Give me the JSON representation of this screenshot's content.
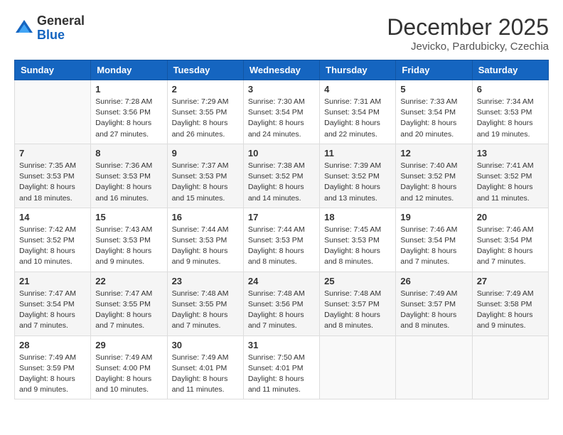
{
  "header": {
    "logo_general": "General",
    "logo_blue": "Blue",
    "month_year": "December 2025",
    "location": "Jevicko, Pardubicky, Czechia"
  },
  "days_of_week": [
    "Sunday",
    "Monday",
    "Tuesday",
    "Wednesday",
    "Thursday",
    "Friday",
    "Saturday"
  ],
  "weeks": [
    [
      {
        "day": "",
        "info": ""
      },
      {
        "day": "1",
        "info": "Sunrise: 7:28 AM\nSunset: 3:56 PM\nDaylight: 8 hours\nand 27 minutes."
      },
      {
        "day": "2",
        "info": "Sunrise: 7:29 AM\nSunset: 3:55 PM\nDaylight: 8 hours\nand 26 minutes."
      },
      {
        "day": "3",
        "info": "Sunrise: 7:30 AM\nSunset: 3:54 PM\nDaylight: 8 hours\nand 24 minutes."
      },
      {
        "day": "4",
        "info": "Sunrise: 7:31 AM\nSunset: 3:54 PM\nDaylight: 8 hours\nand 22 minutes."
      },
      {
        "day": "5",
        "info": "Sunrise: 7:33 AM\nSunset: 3:54 PM\nDaylight: 8 hours\nand 20 minutes."
      },
      {
        "day": "6",
        "info": "Sunrise: 7:34 AM\nSunset: 3:53 PM\nDaylight: 8 hours\nand 19 minutes."
      }
    ],
    [
      {
        "day": "7",
        "info": "Sunrise: 7:35 AM\nSunset: 3:53 PM\nDaylight: 8 hours\nand 18 minutes."
      },
      {
        "day": "8",
        "info": "Sunrise: 7:36 AM\nSunset: 3:53 PM\nDaylight: 8 hours\nand 16 minutes."
      },
      {
        "day": "9",
        "info": "Sunrise: 7:37 AM\nSunset: 3:53 PM\nDaylight: 8 hours\nand 15 minutes."
      },
      {
        "day": "10",
        "info": "Sunrise: 7:38 AM\nSunset: 3:52 PM\nDaylight: 8 hours\nand 14 minutes."
      },
      {
        "day": "11",
        "info": "Sunrise: 7:39 AM\nSunset: 3:52 PM\nDaylight: 8 hours\nand 13 minutes."
      },
      {
        "day": "12",
        "info": "Sunrise: 7:40 AM\nSunset: 3:52 PM\nDaylight: 8 hours\nand 12 minutes."
      },
      {
        "day": "13",
        "info": "Sunrise: 7:41 AM\nSunset: 3:52 PM\nDaylight: 8 hours\nand 11 minutes."
      }
    ],
    [
      {
        "day": "14",
        "info": "Sunrise: 7:42 AM\nSunset: 3:52 PM\nDaylight: 8 hours\nand 10 minutes."
      },
      {
        "day": "15",
        "info": "Sunrise: 7:43 AM\nSunset: 3:53 PM\nDaylight: 8 hours\nand 9 minutes."
      },
      {
        "day": "16",
        "info": "Sunrise: 7:44 AM\nSunset: 3:53 PM\nDaylight: 8 hours\nand 9 minutes."
      },
      {
        "day": "17",
        "info": "Sunrise: 7:44 AM\nSunset: 3:53 PM\nDaylight: 8 hours\nand 8 minutes."
      },
      {
        "day": "18",
        "info": "Sunrise: 7:45 AM\nSunset: 3:53 PM\nDaylight: 8 hours\nand 8 minutes."
      },
      {
        "day": "19",
        "info": "Sunrise: 7:46 AM\nSunset: 3:54 PM\nDaylight: 8 hours\nand 7 minutes."
      },
      {
        "day": "20",
        "info": "Sunrise: 7:46 AM\nSunset: 3:54 PM\nDaylight: 8 hours\nand 7 minutes."
      }
    ],
    [
      {
        "day": "21",
        "info": "Sunrise: 7:47 AM\nSunset: 3:54 PM\nDaylight: 8 hours\nand 7 minutes."
      },
      {
        "day": "22",
        "info": "Sunrise: 7:47 AM\nSunset: 3:55 PM\nDaylight: 8 hours\nand 7 minutes."
      },
      {
        "day": "23",
        "info": "Sunrise: 7:48 AM\nSunset: 3:55 PM\nDaylight: 8 hours\nand 7 minutes."
      },
      {
        "day": "24",
        "info": "Sunrise: 7:48 AM\nSunset: 3:56 PM\nDaylight: 8 hours\nand 7 minutes."
      },
      {
        "day": "25",
        "info": "Sunrise: 7:48 AM\nSunset: 3:57 PM\nDaylight: 8 hours\nand 8 minutes."
      },
      {
        "day": "26",
        "info": "Sunrise: 7:49 AM\nSunset: 3:57 PM\nDaylight: 8 hours\nand 8 minutes."
      },
      {
        "day": "27",
        "info": "Sunrise: 7:49 AM\nSunset: 3:58 PM\nDaylight: 8 hours\nand 9 minutes."
      }
    ],
    [
      {
        "day": "28",
        "info": "Sunrise: 7:49 AM\nSunset: 3:59 PM\nDaylight: 8 hours\nand 9 minutes."
      },
      {
        "day": "29",
        "info": "Sunrise: 7:49 AM\nSunset: 4:00 PM\nDaylight: 8 hours\nand 10 minutes."
      },
      {
        "day": "30",
        "info": "Sunrise: 7:49 AM\nSunset: 4:01 PM\nDaylight: 8 hours\nand 11 minutes."
      },
      {
        "day": "31",
        "info": "Sunrise: 7:50 AM\nSunset: 4:01 PM\nDaylight: 8 hours\nand 11 minutes."
      },
      {
        "day": "",
        "info": ""
      },
      {
        "day": "",
        "info": ""
      },
      {
        "day": "",
        "info": ""
      }
    ]
  ]
}
